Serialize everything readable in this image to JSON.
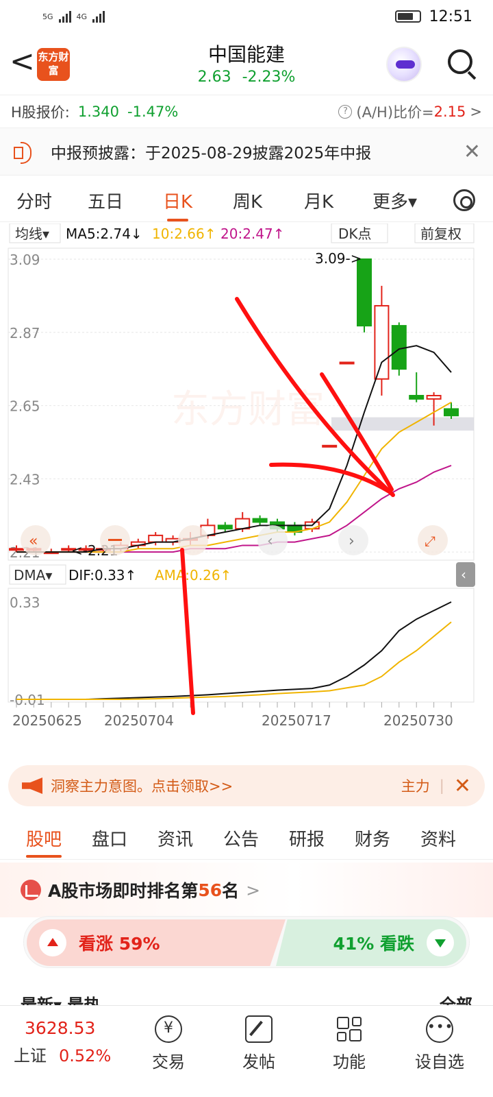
{
  "status": {
    "time": "12:51",
    "network": "5G",
    "network2": "4G"
  },
  "header": {
    "back": "<",
    "logo": "东方财富",
    "title": "中国能建",
    "price": "2.63",
    "change": "-2.23%"
  },
  "hshare": {
    "label": "H股报价:",
    "price": "1.340",
    "change": "-1.47%",
    "ah_label": "(A/H)比价=",
    "ah_value": "2.15",
    "chevron": ">"
  },
  "notice": {
    "text": "中报预披露：于2025-08-29披露2025年中报",
    "close": "✕"
  },
  "tabs": [
    "分时",
    "五日",
    "日K",
    "周K",
    "月K",
    "更多▾"
  ],
  "active_tab": "日K",
  "chart_header": {
    "ma_select": "均线▾",
    "ma5": "MA5:2.74↓",
    "ma10": "10:2.66↑",
    "ma20": "20:2.47↑",
    "dk": "DK点",
    "adjust": "前复权"
  },
  "indicator_header": {
    "select": "DMA▾",
    "dif": "DIF:0.33↑",
    "ama": "AMA:0.26↑"
  },
  "chart_data": [
    {
      "type": "candlestick",
      "y_ticks": [
        "3.09",
        "2.87",
        "2.65",
        "2.43",
        "2.21"
      ],
      "ylim": [
        2.2,
        3.09
      ],
      "annotations": [
        "3.09->",
        "<-2.21"
      ],
      "colors": {
        "up": "#e2231a",
        "down": "#17a317",
        "ma5": "#111111",
        "ma10": "#f0b400",
        "ma20": "#c0158a"
      },
      "candles": [
        {
          "o": 2.22,
          "c": 2.22,
          "h": 2.23,
          "l": 2.21
        },
        {
          "o": 2.22,
          "c": 2.22,
          "h": 2.22,
          "l": 2.21
        },
        {
          "o": 2.21,
          "c": 2.21,
          "h": 2.22,
          "l": 2.21
        },
        {
          "o": 2.22,
          "c": 2.22,
          "h": 2.23,
          "l": 2.21
        },
        {
          "o": 2.22,
          "c": 2.22,
          "h": 2.23,
          "l": 2.21
        },
        {
          "o": 2.22,
          "c": 2.22,
          "h": 2.23,
          "l": 2.21
        },
        {
          "o": 2.22,
          "c": 2.23,
          "h": 2.24,
          "l": 2.21
        },
        {
          "o": 2.23,
          "c": 2.24,
          "h": 2.25,
          "l": 2.22
        },
        {
          "o": 2.24,
          "c": 2.26,
          "h": 2.27,
          "l": 2.23
        },
        {
          "o": 2.24,
          "c": 2.25,
          "h": 2.26,
          "l": 2.23
        },
        {
          "o": 2.25,
          "c": 2.25,
          "h": 2.27,
          "l": 2.23
        },
        {
          "o": 2.26,
          "c": 2.29,
          "h": 2.31,
          "l": 2.25
        },
        {
          "o": 2.29,
          "c": 2.28,
          "h": 2.3,
          "l": 2.27
        },
        {
          "o": 2.28,
          "c": 2.31,
          "h": 2.33,
          "l": 2.27
        },
        {
          "o": 2.31,
          "c": 2.3,
          "h": 2.32,
          "l": 2.29
        },
        {
          "o": 2.3,
          "c": 2.28,
          "h": 2.31,
          "l": 2.27
        },
        {
          "o": 2.29,
          "c": 2.27,
          "h": 2.3,
          "l": 2.26
        },
        {
          "o": 2.28,
          "c": 2.3,
          "h": 2.31,
          "l": 2.27
        },
        {
          "o": 2.53,
          "c": 2.53,
          "h": 2.53,
          "l": 2.53
        },
        {
          "o": 2.78,
          "c": 2.78,
          "h": 2.78,
          "l": 2.78
        },
        {
          "o": 3.09,
          "c": 2.89,
          "h": 3.09,
          "l": 2.87
        },
        {
          "o": 2.73,
          "c": 2.95,
          "h": 3.01,
          "l": 2.68
        },
        {
          "o": 2.89,
          "c": 2.76,
          "h": 2.9,
          "l": 2.74
        },
        {
          "o": 2.68,
          "c": 2.67,
          "h": 2.75,
          "l": 2.66
        },
        {
          "o": 2.67,
          "c": 2.68,
          "h": 2.69,
          "l": 2.59
        },
        {
          "o": 2.64,
          "c": 2.62,
          "h": 2.66,
          "l": 2.61
        }
      ],
      "ma5": [
        2.21,
        2.21,
        2.21,
        2.21,
        2.21,
        2.22,
        2.22,
        2.23,
        2.24,
        2.24,
        2.25,
        2.26,
        2.27,
        2.28,
        2.29,
        2.29,
        2.29,
        2.29,
        2.34,
        2.47,
        2.63,
        2.78,
        2.82,
        2.83,
        2.81,
        2.75
      ],
      "ma10": [
        2.21,
        2.21,
        2.21,
        2.21,
        2.21,
        2.21,
        2.21,
        2.22,
        2.22,
        2.22,
        2.23,
        2.23,
        2.24,
        2.25,
        2.26,
        2.27,
        2.27,
        2.28,
        2.3,
        2.36,
        2.44,
        2.52,
        2.57,
        2.6,
        2.63,
        2.66
      ],
      "ma20": [
        2.21,
        2.21,
        2.21,
        2.21,
        2.21,
        2.21,
        2.21,
        2.21,
        2.21,
        2.21,
        2.22,
        2.22,
        2.22,
        2.23,
        2.23,
        2.24,
        2.24,
        2.25,
        2.26,
        2.29,
        2.33,
        2.37,
        2.4,
        2.42,
        2.45,
        2.47
      ],
      "band": [
        2.575,
        2.615
      ]
    },
    {
      "type": "line",
      "y_ticks": [
        "0.33",
        "-0.01"
      ],
      "ylim": [
        -0.01,
        0.33
      ],
      "x_labels": [
        "20250625",
        "20250704",
        "20250717",
        "20250730"
      ],
      "series": [
        {
          "name": "DIF",
          "color": "#111111",
          "values": [
            -0.01,
            -0.01,
            -0.01,
            -0.01,
            -0.01,
            -0.008,
            -0.006,
            -0.004,
            -0.002,
            0.0,
            0.003,
            0.006,
            0.01,
            0.014,
            0.018,
            0.022,
            0.025,
            0.028,
            0.04,
            0.07,
            0.11,
            0.16,
            0.23,
            0.27,
            0.3,
            0.33
          ]
        },
        {
          "name": "AMA",
          "color": "#f0b400",
          "values": [
            -0.01,
            -0.01,
            -0.01,
            -0.01,
            -0.01,
            -0.01,
            -0.01,
            -0.009,
            -0.008,
            -0.006,
            -0.004,
            -0.002,
            0.0,
            0.003,
            0.006,
            0.01,
            0.013,
            0.016,
            0.02,
            0.03,
            0.04,
            0.07,
            0.12,
            0.16,
            0.21,
            0.26
          ]
        }
      ]
    }
  ],
  "promo": {
    "text": "洞察主力意图。点击领取>>",
    "right": "主力",
    "close": "✕"
  },
  "sub_tabs": [
    "股吧",
    "盘口",
    "资讯",
    "公告",
    "研报",
    "财务",
    "资料"
  ],
  "rank": {
    "prefix": "A股市场即时排名第",
    "num": "56",
    "suffix": "名",
    "chevron": ">"
  },
  "vote": {
    "up": "看涨 59%",
    "down": "41% 看跌"
  },
  "partial": {
    "left": "最新▾ 最热",
    "right": "全部"
  },
  "bottom_nav": {
    "index_value": "3628.53",
    "index_name": "上证",
    "index_pct": "0.52%",
    "items": [
      "交易",
      "发帖",
      "功能",
      "设自选"
    ]
  }
}
